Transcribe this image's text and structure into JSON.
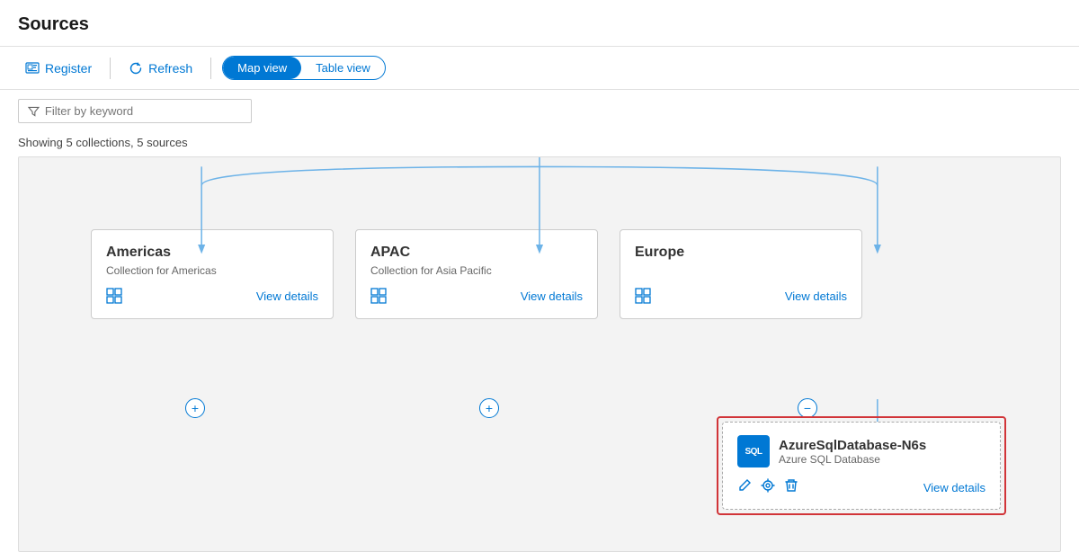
{
  "page": {
    "title": "Sources"
  },
  "toolbar": {
    "register_label": "Register",
    "refresh_label": "Refresh",
    "map_view_label": "Map view",
    "table_view_label": "Table view"
  },
  "filter": {
    "placeholder": "Filter by keyword"
  },
  "showing": {
    "text": "Showing 5 collections, 5 sources"
  },
  "collections": [
    {
      "title": "Americas",
      "subtitle": "Collection for Americas",
      "view_details": "View details"
    },
    {
      "title": "APAC",
      "subtitle": "Collection for Asia Pacific",
      "view_details": "View details"
    },
    {
      "title": "Europe",
      "subtitle": "",
      "view_details": "View details"
    }
  ],
  "source": {
    "name": "AzureSqlDatabase-N6s",
    "type": "Azure SQL Database",
    "icon_label": "SQL",
    "view_details": "View details"
  },
  "colors": {
    "accent": "#0078d4",
    "danger": "#d13438"
  }
}
